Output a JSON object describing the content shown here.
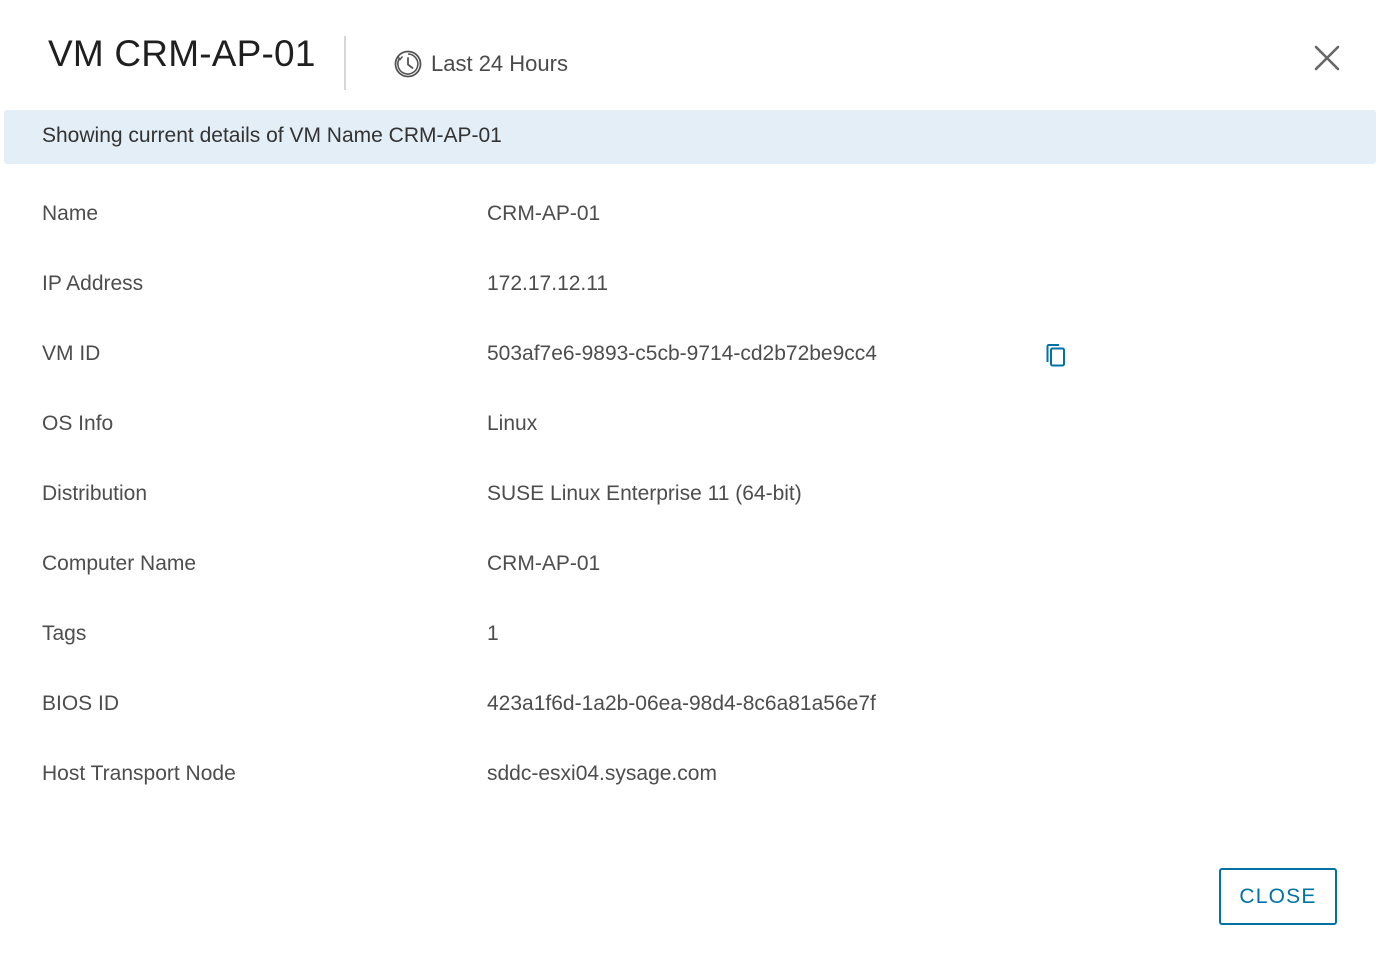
{
  "dialog": {
    "title": "VM CRM-AP-01",
    "time_range": "Last 24 Hours",
    "banner": "Showing current details of VM Name CRM-AP-01",
    "close_button": "CLOSE"
  },
  "details": [
    {
      "key": "Name",
      "value": "CRM-AP-01"
    },
    {
      "key": "IP Address",
      "value": "172.17.12.11"
    },
    {
      "key": "VM ID",
      "value": "503af7e6-9893-c5cb-9714-cd2b72be9cc4"
    },
    {
      "key": "OS Info",
      "value": "Linux"
    },
    {
      "key": "Distribution",
      "value": "SUSE Linux Enterprise 11 (64-bit)"
    },
    {
      "key": "Computer Name",
      "value": "CRM-AP-01"
    },
    {
      "key": "Tags",
      "value": "1"
    },
    {
      "key": "BIOS ID",
      "value": "423a1f6d-1a2b-06ea-98d4-8c6a81a56e7f"
    },
    {
      "key": "Host Transport Node",
      "value": "sddc-esxi04.sysage.com"
    }
  ],
  "icons": {
    "clock": "clock-icon",
    "close": "close-icon",
    "copy": "copy-icon"
  },
  "colors": {
    "accent": "#0072a3",
    "banner_bg": "#e3eef7"
  }
}
